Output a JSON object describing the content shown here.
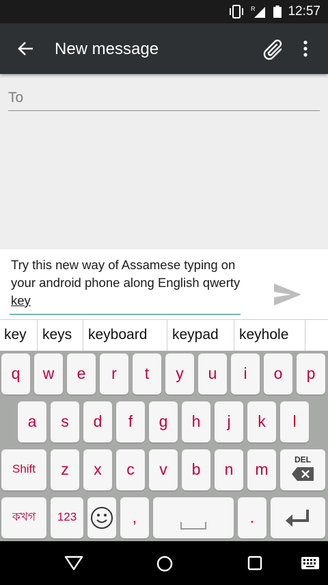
{
  "status_bar": {
    "time": "12:57",
    "signal_label": "R"
  },
  "app_bar": {
    "title": "New message"
  },
  "recipient": {
    "placeholder": "To",
    "value": ""
  },
  "compose": {
    "text_before": "Try this new way of Assamese typing on your android phone along English qwerty ",
    "text_underlined": "key"
  },
  "suggestions": [
    "key",
    "keys",
    "keyboard",
    "keypad",
    "keyhole"
  ],
  "keyboard": {
    "row1": [
      "q",
      "w",
      "e",
      "r",
      "t",
      "y",
      "u",
      "i",
      "o",
      "p"
    ],
    "row2": [
      "a",
      "s",
      "d",
      "f",
      "g",
      "h",
      "j",
      "k",
      "l"
    ],
    "row3": [
      "z",
      "x",
      "c",
      "v",
      "b",
      "n",
      "m"
    ],
    "shift_label": "Shift",
    "del_label": "DEL",
    "lang_label": "কখগ",
    "num_label": "123",
    "comma_label": ",",
    "period_label": "."
  },
  "colors": {
    "key_text": "#c2003a",
    "app_bar": "#2d3134",
    "keyboard_bg": "#a8aaa8",
    "accent_underline": "#70b9b3"
  },
  "icons": [
    "vibrate-icon",
    "signal-icon",
    "battery-icon",
    "back-arrow-icon",
    "attach-icon",
    "more-vert-icon",
    "send-icon",
    "emoji-icon",
    "space-icon",
    "enter-icon",
    "backspace-icon",
    "nav-back-icon",
    "nav-home-icon",
    "nav-recents-icon",
    "keyboard-switch-icon"
  ]
}
